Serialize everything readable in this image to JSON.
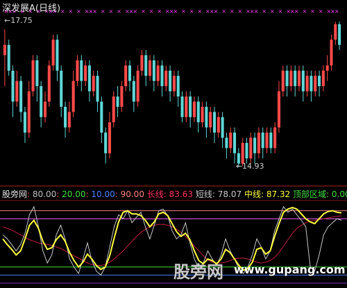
{
  "chart_data": [
    {
      "type": "candlestick",
      "title": "深发展A(日线)",
      "high_label": "17.75",
      "low_label": "14.93",
      "ylim": [
        14.7,
        17.9
      ],
      "marker_color": "#ff40ff",
      "up_color": "#ff4a4a",
      "down_color": "#5fd7d7",
      "candles": [
        [
          17.1,
          17.3,
          16.5,
          17.6
        ],
        [
          17.3,
          16.8,
          16.7,
          17.4
        ],
        [
          16.8,
          16.2,
          15.9,
          16.9
        ],
        [
          16.2,
          16.6,
          16.1,
          16.8
        ],
        [
          16.6,
          16.0,
          15.8,
          16.7
        ],
        [
          16.0,
          15.6,
          15.4,
          16.1
        ],
        [
          15.6,
          16.4,
          15.5,
          16.6
        ],
        [
          16.4,
          17.0,
          16.3,
          17.1
        ],
        [
          17.0,
          16.5,
          16.2,
          17.1
        ],
        [
          16.5,
          15.9,
          15.7,
          16.6
        ],
        [
          15.9,
          16.2,
          15.8,
          16.4
        ],
        [
          16.2,
          16.9,
          16.1,
          17.0
        ],
        [
          16.9,
          17.4,
          16.8,
          17.5
        ],
        [
          17.4,
          16.8,
          16.6,
          17.5
        ],
        [
          16.8,
          16.1,
          15.9,
          16.9
        ],
        [
          16.1,
          15.7,
          15.5,
          16.2
        ],
        [
          15.7,
          16.0,
          15.6,
          16.2
        ],
        [
          16.0,
          16.6,
          15.9,
          16.8
        ],
        [
          16.6,
          17.0,
          16.5,
          17.1
        ],
        [
          17.0,
          16.6,
          16.4,
          17.1
        ],
        [
          16.6,
          16.9,
          16.5,
          17.0
        ],
        [
          16.9,
          16.4,
          16.2,
          17.0
        ],
        [
          16.4,
          16.7,
          16.3,
          16.8
        ],
        [
          16.7,
          16.2,
          16.0,
          16.8
        ],
        [
          16.2,
          15.6,
          15.4,
          16.3
        ],
        [
          15.6,
          15.2,
          15.0,
          15.7
        ],
        [
          15.2,
          15.8,
          15.1,
          16.0
        ],
        [
          15.8,
          16.3,
          15.7,
          16.4
        ],
        [
          16.3,
          16.1,
          15.9,
          16.5
        ],
        [
          16.1,
          16.5,
          16.0,
          16.6
        ],
        [
          16.5,
          16.9,
          16.4,
          17.0
        ],
        [
          16.9,
          16.6,
          16.4,
          17.0
        ],
        [
          16.6,
          16.2,
          16.0,
          16.7
        ],
        [
          16.2,
          16.8,
          16.1,
          16.9
        ],
        [
          16.8,
          17.1,
          16.7,
          17.2
        ],
        [
          17.1,
          16.7,
          16.5,
          17.2
        ],
        [
          16.7,
          17.0,
          16.6,
          17.1
        ],
        [
          17.0,
          16.6,
          16.4,
          17.1
        ],
        [
          16.6,
          16.9,
          16.5,
          17.0
        ],
        [
          16.9,
          16.5,
          16.3,
          17.0
        ],
        [
          16.5,
          16.8,
          16.4,
          16.9
        ],
        [
          16.8,
          16.4,
          16.2,
          16.9
        ],
        [
          16.4,
          16.7,
          16.3,
          16.8
        ],
        [
          16.7,
          16.3,
          16.1,
          16.8
        ],
        [
          16.3,
          15.9,
          15.8,
          16.4
        ],
        [
          15.9,
          16.3,
          15.8,
          16.4
        ],
        [
          16.3,
          15.9,
          15.7,
          16.4
        ],
        [
          15.9,
          16.2,
          15.8,
          16.3
        ],
        [
          16.2,
          15.8,
          15.6,
          16.3
        ],
        [
          15.8,
          16.1,
          15.7,
          16.2
        ],
        [
          16.1,
          15.7,
          15.5,
          16.2
        ],
        [
          15.7,
          16.0,
          15.6,
          16.1
        ],
        [
          16.0,
          15.6,
          15.4,
          16.1
        ],
        [
          15.6,
          15.9,
          15.5,
          16.0
        ],
        [
          15.9,
          15.5,
          15.3,
          16.0
        ],
        [
          15.5,
          15.3,
          15.1,
          15.6
        ],
        [
          15.3,
          15.6,
          15.2,
          15.7
        ],
        [
          15.6,
          15.2,
          15.0,
          15.7
        ],
        [
          15.2,
          15.0,
          14.93,
          15.3
        ],
        [
          15.0,
          15.4,
          14.95,
          15.5
        ],
        [
          15.4,
          15.1,
          15.0,
          15.5
        ],
        [
          15.1,
          15.5,
          15.0,
          15.6
        ],
        [
          15.5,
          15.2,
          15.0,
          15.6
        ],
        [
          15.2,
          15.6,
          15.1,
          15.7
        ],
        [
          15.6,
          15.3,
          15.1,
          15.7
        ],
        [
          15.3,
          15.6,
          15.2,
          15.7
        ],
        [
          15.6,
          15.3,
          15.2,
          15.7
        ],
        [
          15.3,
          15.7,
          15.2,
          15.8
        ],
        [
          15.7,
          16.4,
          15.6,
          16.6
        ],
        [
          16.4,
          16.8,
          16.3,
          16.9
        ],
        [
          16.8,
          16.5,
          16.3,
          16.9
        ],
        [
          16.5,
          16.8,
          16.4,
          16.9
        ],
        [
          16.8,
          16.5,
          16.3,
          16.9
        ],
        [
          16.5,
          16.8,
          16.4,
          16.9
        ],
        [
          16.8,
          16.4,
          16.2,
          16.9
        ],
        [
          16.4,
          16.7,
          16.3,
          16.8
        ],
        [
          16.7,
          16.4,
          16.2,
          16.8
        ],
        [
          16.4,
          16.7,
          16.3,
          16.8
        ],
        [
          16.7,
          16.5,
          16.3,
          16.8
        ],
        [
          16.5,
          16.8,
          16.4,
          16.9
        ],
        [
          16.8,
          16.9,
          16.6,
          17.1
        ],
        [
          16.9,
          17.4,
          16.8,
          17.5
        ],
        [
          17.4,
          17.7,
          17.3,
          17.75
        ],
        [
          17.7,
          17.3,
          17.2,
          17.75
        ]
      ]
    },
    {
      "type": "line",
      "legend_title": "股旁网",
      "ylim": [
        0,
        100
      ],
      "levels": [
        {
          "name": "80.00",
          "value": 80,
          "color": "#ff60ff",
          "label_color": "#c0c0c0"
        },
        {
          "name": "20.00",
          "value": 20,
          "color": "#40e040",
          "label_color": "#40e040"
        },
        {
          "name": "10.00",
          "value": 10,
          "color": "#5080ff",
          "label_color": "#5080ff"
        },
        {
          "name": "90.00",
          "value": 90,
          "color": "#ff8080",
          "label_color": "#ff8080"
        }
      ],
      "series": [
        {
          "name": "长线",
          "value_label": "83.63",
          "color": "#c02040",
          "values": [
            70,
            68,
            66,
            63,
            60,
            57,
            54,
            52,
            50,
            49,
            48,
            47,
            45,
            43,
            40,
            37,
            34,
            31,
            28,
            25,
            23,
            22,
            22,
            23,
            26,
            30,
            35,
            40,
            46,
            52,
            58,
            63,
            67,
            70,
            72,
            73,
            73,
            72,
            70,
            67,
            63,
            58,
            52,
            46,
            40,
            34,
            29,
            26,
            25,
            25,
            26,
            28,
            30,
            31,
            31,
            30,
            28,
            26,
            25,
            26,
            28,
            32,
            38,
            46,
            54,
            62,
            68,
            72,
            75,
            77,
            78,
            79,
            80,
            81,
            82,
            83,
            83.63
          ]
        },
        {
          "name": "短线",
          "value_label": "78.07",
          "color": "#c8c8c8",
          "values": [
            60,
            55,
            48,
            40,
            48,
            62,
            85,
            95,
            70,
            40,
            25,
            35,
            60,
            72,
            55,
            30,
            20,
            12,
            30,
            50,
            28,
            15,
            10,
            20,
            45,
            70,
            85,
            80,
            90,
            75,
            82,
            88,
            70,
            55,
            72,
            90,
            92,
            84,
            65,
            55,
            60,
            75,
            50,
            30,
            18,
            25,
            40,
            30,
            22,
            35,
            55,
            40,
            30,
            18,
            12,
            20,
            35,
            55,
            45,
            30,
            40,
            65,
            80,
            95,
            88,
            92,
            85,
            78,
            70,
            20,
            15,
            35,
            60,
            70,
            75,
            80,
            78.07
          ]
        },
        {
          "name": "中线",
          "value_label": "87.32",
          "color": "#ffff40",
          "values": [
            55,
            48,
            42,
            35,
            40,
            55,
            72,
            78,
            68,
            52,
            42,
            44,
            54,
            60,
            52,
            38,
            28,
            20,
            26,
            36,
            30,
            22,
            17,
            20,
            34,
            56,
            76,
            88,
            90,
            86,
            86,
            84,
            78,
            70,
            76,
            86,
            88,
            84,
            74,
            64,
            58,
            62,
            54,
            40,
            28,
            24,
            30,
            28,
            24,
            30,
            42,
            38,
            30,
            22,
            16,
            18,
            26,
            42,
            44,
            36,
            40,
            58,
            74,
            88,
            92,
            94,
            92,
            86,
            80,
            76,
            74,
            80,
            86,
            89,
            90,
            88,
            87.32
          ]
        }
      ],
      "zone": {
        "name": "顶部区域",
        "value_label": "0.00",
        "color": "#40e040"
      }
    }
  ],
  "watermark": {
    "text": "股旁网",
    "url": "www.gupang.com"
  }
}
